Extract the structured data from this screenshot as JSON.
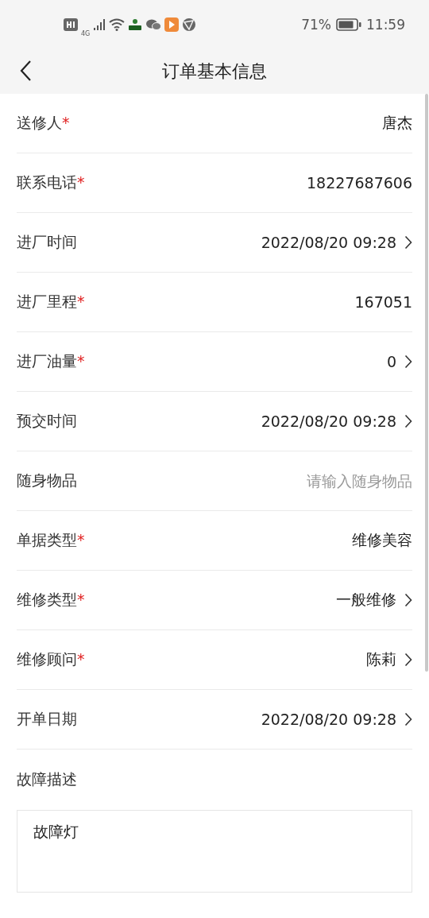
{
  "status_bar": {
    "battery": "71%",
    "time": "11:59",
    "network": "4G"
  },
  "nav": {
    "title": "订单基本信息"
  },
  "fields": [
    {
      "label": "送修人",
      "mark": "*",
      "value": "唐杰",
      "chevron": false
    },
    {
      "label": "联系电话",
      "mark": "*",
      "value": "18227687606",
      "chevron": false
    },
    {
      "label": "进厂时间",
      "value": "2022/08/20 09:28",
      "chevron": true
    },
    {
      "label": "进厂里程",
      "mark": "*",
      "value": "167051",
      "chevron": false
    },
    {
      "label": "进厂油量",
      "mark": "*",
      "value": "0",
      "chevron": true
    },
    {
      "label": "预交时间",
      "value": "2022/08/20 09:28",
      "chevron": true
    },
    {
      "label": "随身物品",
      "placeholder": "请输入随身物品",
      "chevron": false
    },
    {
      "label": "单据类型",
      "mark": "*",
      "value": "维修美容",
      "chevron": false
    },
    {
      "label": "维修类型",
      "mark": "*",
      "value": "一般维修",
      "chevron": true
    },
    {
      "label": "维修顾问",
      "mark": "*",
      "value": "陈莉",
      "chevron": true
    },
    {
      "label": "开单日期",
      "value": "2022/08/20 09:28",
      "chevron": true
    }
  ],
  "fault": {
    "label": "故障描述",
    "value": "故障灯"
  }
}
